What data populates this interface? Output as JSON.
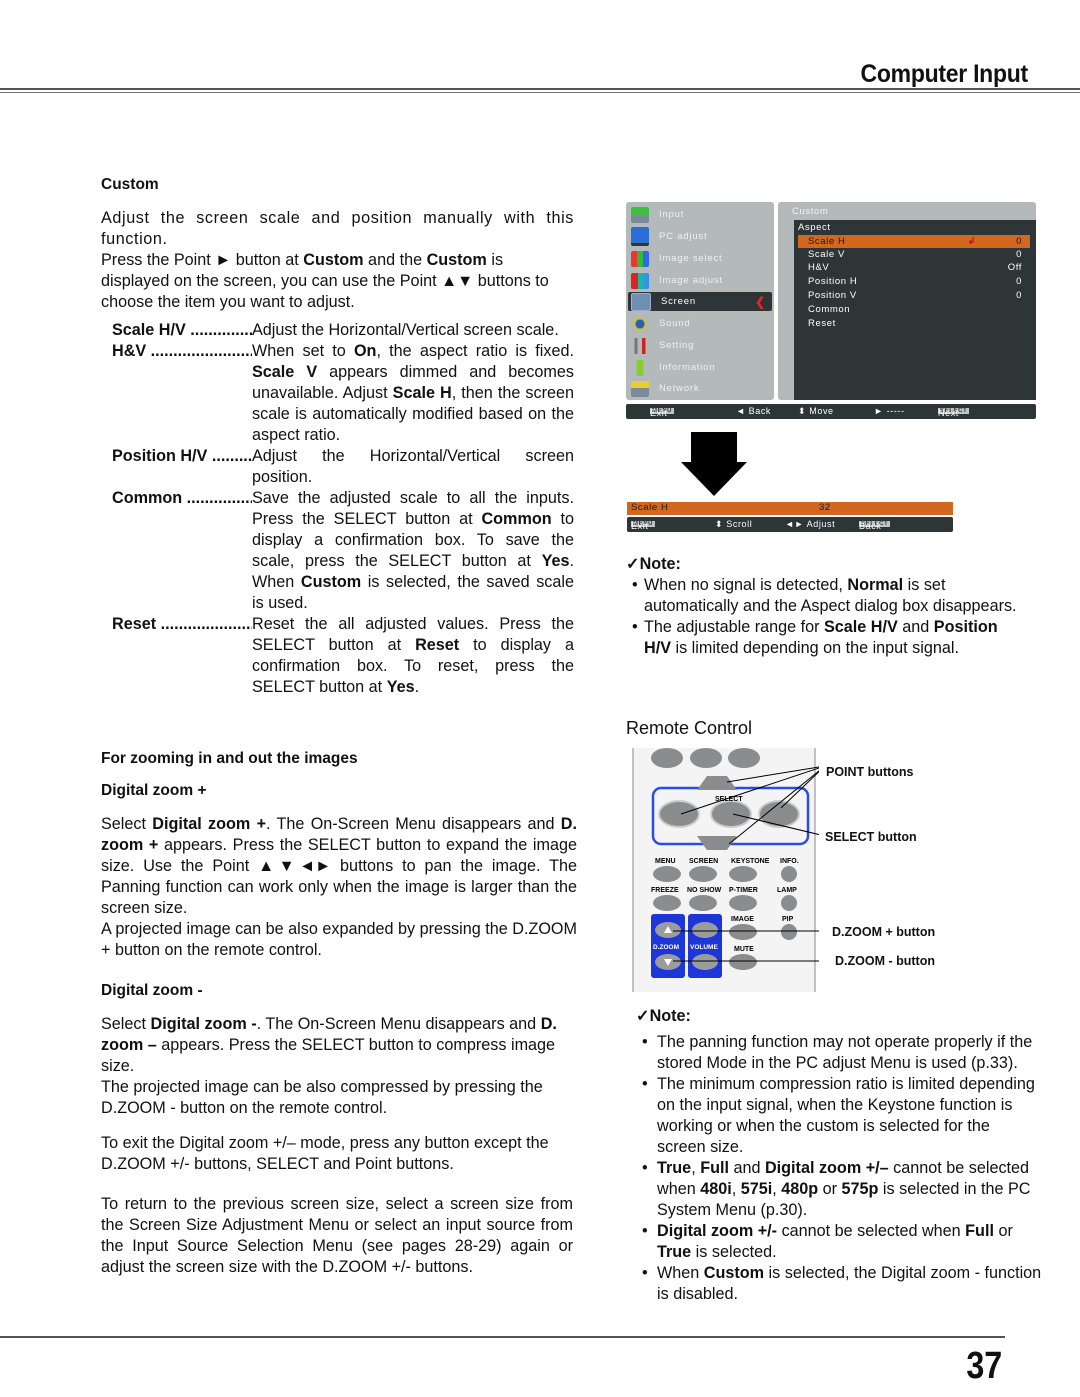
{
  "header": {
    "title": "Computer Input"
  },
  "page_number": "37",
  "custom": {
    "heading": "Custom",
    "intro": "Adjust the screen scale and position manually with this function.",
    "press_parts": [
      "Press the Point ► button at ",
      "Custom",
      " and the ",
      "Custom",
      " is displayed on the screen, you can use the Point ▲▼ buttons to choose the item you want to adjust."
    ],
    "items": [
      {
        "term": "Scale H/V ..................",
        "desc": "Adjust the Horizontal/Vertical screen scale."
      },
      {
        "term": "H&V ..............................",
        "desc_parts": [
          "When set to ",
          "On",
          ", the aspect ratio is fixed. ",
          "Scale V",
          " appears dimmed and becomes unavailable. Adjust ",
          "Scale H",
          ", then the screen scale is automatically modified based on the aspect ratio."
        ]
      },
      {
        "term": "Position H/V ...............",
        "desc": "Adjust the Horizontal/Vertical screen position."
      },
      {
        "term": "Common .........................",
        "desc_parts": [
          "Save the adjusted scale to all the inputs. Press the SELECT button at ",
          "Common",
          " to display a confirmation box. To save the scale, press the SELECT button at ",
          "Yes",
          ". When ",
          "Custom",
          " is selected, the saved scale is used."
        ]
      },
      {
        "term": "Reset ...............................",
        "desc_parts": [
          "Reset the all adjusted values. Press the SELECT button at ",
          "Reset",
          " to display a confirmation box. To reset, press the SELECT button at ",
          "Yes",
          "."
        ]
      }
    ]
  },
  "zoom": {
    "heading": "For zooming in and out the images",
    "plus": {
      "heading": "Digital zoom +",
      "p1_parts": [
        "Select ",
        "Digital zoom +",
        ". The On-Screen Menu disappears and ",
        "D. zoom +",
        " appears. Press the SELECT button to expand the image size. Use the Point ▲▼◄► buttons to pan the image. The Panning function can work only when the image is larger than the screen size."
      ],
      "p2": "A projected image can be also expanded by pressing the D.ZOOM + button on the remote control."
    },
    "minus": {
      "heading": "Digital zoom -",
      "p1_parts": [
        "Select ",
        "Digital zoom -",
        ". The On-Screen Menu disappears and ",
        "D. zoom –",
        " appears. Press the SELECT button to compress image size."
      ],
      "p2": "The projected image can be also compressed by pressing the D.ZOOM - button on the remote control."
    },
    "exit": "To exit the Digital zoom +/– mode, press any button except the D.ZOOM +/- buttons, SELECT and Point buttons.",
    "return": "To return to the previous screen size, select a screen size from the Screen Size Adjustment Menu or select an input source from the Input Source Selection Menu (see pages 28-29) again or adjust the screen size with the D.ZOOM +/- buttons."
  },
  "osd": {
    "menu_items": [
      {
        "label": "Input",
        "icon": "input-icon"
      },
      {
        "label": "PC adjust",
        "icon": "pc-adjust-icon"
      },
      {
        "label": "Image select",
        "icon": "image-select-icon"
      },
      {
        "label": "Image adjust",
        "icon": "image-adjust-icon"
      },
      {
        "label": "Screen",
        "icon": "screen-icon",
        "selected": true
      },
      {
        "label": "Sound",
        "icon": "sound-icon"
      },
      {
        "label": "Setting",
        "icon": "setting-icon"
      },
      {
        "label": "Information",
        "icon": "information-icon"
      },
      {
        "label": "Network",
        "icon": "network-icon"
      }
    ],
    "submenu_title": "Custom",
    "submenu_header": "Aspect",
    "rows": [
      {
        "label": "Scale H",
        "value": "0",
        "selected": true
      },
      {
        "label": "Scale V",
        "value": "0"
      },
      {
        "label": "H&V",
        "value": "Off"
      },
      {
        "label": "Position H",
        "value": "0"
      },
      {
        "label": "Position V",
        "value": "0"
      },
      {
        "label": "Common",
        "value": ""
      },
      {
        "label": "Reset",
        "value": ""
      }
    ],
    "help": {
      "menu_key": "MENU",
      "exit": "Exit",
      "back": "◄ Back",
      "move": "⬍ Move",
      "dash": "► -----",
      "select_key": "SELECT",
      "next": "Next"
    },
    "accent": "#d2671f"
  },
  "adjust_bar": {
    "label": "Scale H",
    "value": "32",
    "help": {
      "menu_key": "MENU",
      "exit": "Exit",
      "scroll": "⬍ Scroll",
      "adjust": "◄► Adjust",
      "select_key": "SELECT",
      "back": "Back"
    }
  },
  "note1": {
    "heading": "✓Note:",
    "bullets": [
      [
        "When no signal is detected, ",
        "Normal",
        " is set automatically and the Aspect dialog box disappears."
      ],
      [
        "The adjustable range for ",
        "Scale H/V",
        " and ",
        "Position H/V",
        " is limited depending on the input signal."
      ]
    ]
  },
  "remote": {
    "title": "Remote Control",
    "button_labels": [
      "SELECT",
      "MENU",
      "SCREEN",
      "KEYSTONE",
      "INFO.",
      "FREEZE",
      "NO SHOW",
      "P-TIMER",
      "LAMP",
      "IMAGE",
      "PIP",
      "D.ZOOM",
      "VOLUME",
      "MUTE"
    ],
    "callouts": [
      "POINT buttons",
      "SELECT button",
      "D.ZOOM + button",
      "D.ZOOM - button"
    ]
  },
  "note2": {
    "heading": "✓Note:",
    "bullets": [
      [
        "The panning function may not operate properly if the stored Mode in the PC adjust Menu is used (p.33)."
      ],
      [
        "The minimum compression ratio is limited depending on the input signal, when the Keystone function is working or when the custom is selected for the screen size."
      ],
      [
        "",
        "True",
        ", ",
        "Full",
        " and ",
        "Digital zoom +/–",
        " cannot be selected when ",
        "480i",
        ", ",
        "575i",
        ", ",
        "480p",
        " or ",
        "575p",
        " is selected in the PC System Menu (p.30)."
      ],
      [
        "",
        "Digital zoom +/-",
        " cannot be selected when ",
        "Full",
        " or ",
        "True",
        " is selected."
      ],
      [
        "When ",
        "Custom",
        " is selected, the Digital zoom - function is disabled."
      ]
    ]
  }
}
